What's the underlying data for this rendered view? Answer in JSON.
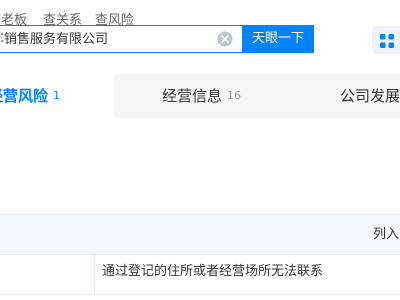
{
  "search_tabs": [
    "查老板",
    "查关系",
    "查风险"
  ],
  "search": {
    "value": "车销售服务有限公司",
    "button_label": "天眼一下"
  },
  "tabs": [
    {
      "label": "经营风险",
      "count": "1",
      "active": true
    },
    {
      "label": "经营信息",
      "count": "16",
      "active": false
    },
    {
      "label": "公司发展",
      "count": "",
      "active": false
    }
  ],
  "table": {
    "header_label": "列入",
    "rows": [
      {
        "reason": "通过登记的住所或者经营场所无法联系"
      }
    ]
  },
  "colors": {
    "accent": "#0084ff",
    "tab_bar_bg": "#f5f6f8",
    "table_header_bg": "#f2f7ff"
  },
  "icons": {
    "clear": "circle-x-icon",
    "apps": "grid-apps-icon"
  }
}
